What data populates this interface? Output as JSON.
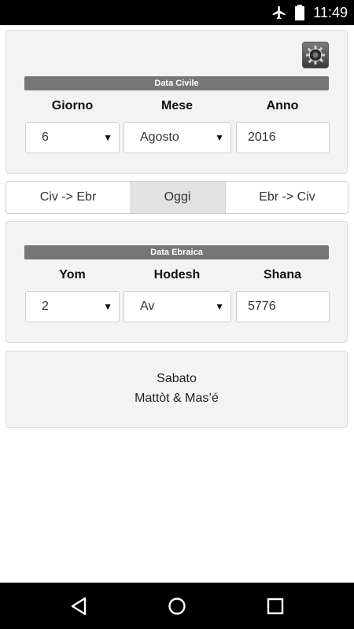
{
  "status": {
    "time": "11:49"
  },
  "civil": {
    "header": "Data Civile",
    "labels": {
      "day": "Giorno",
      "month": "Mese",
      "year": "Anno"
    },
    "values": {
      "day": "6",
      "month": "Agosto",
      "year": "2016"
    }
  },
  "segments": {
    "left": "Civ -> Ebr",
    "mid": "Oggi",
    "right": "Ebr -> Civ"
  },
  "hebrew": {
    "header": "Data Ebraica",
    "labels": {
      "day": "Yom",
      "month": "Hodesh",
      "year": "Shana"
    },
    "values": {
      "day": "2",
      "month": "Av",
      "year": "5776"
    }
  },
  "result": {
    "line1": "Sabato",
    "line2": "Mattòt & Mas’é"
  },
  "icons": {
    "settings": "gear-icon",
    "back": "back-icon",
    "home": "home-icon",
    "recents": "recents-icon"
  }
}
